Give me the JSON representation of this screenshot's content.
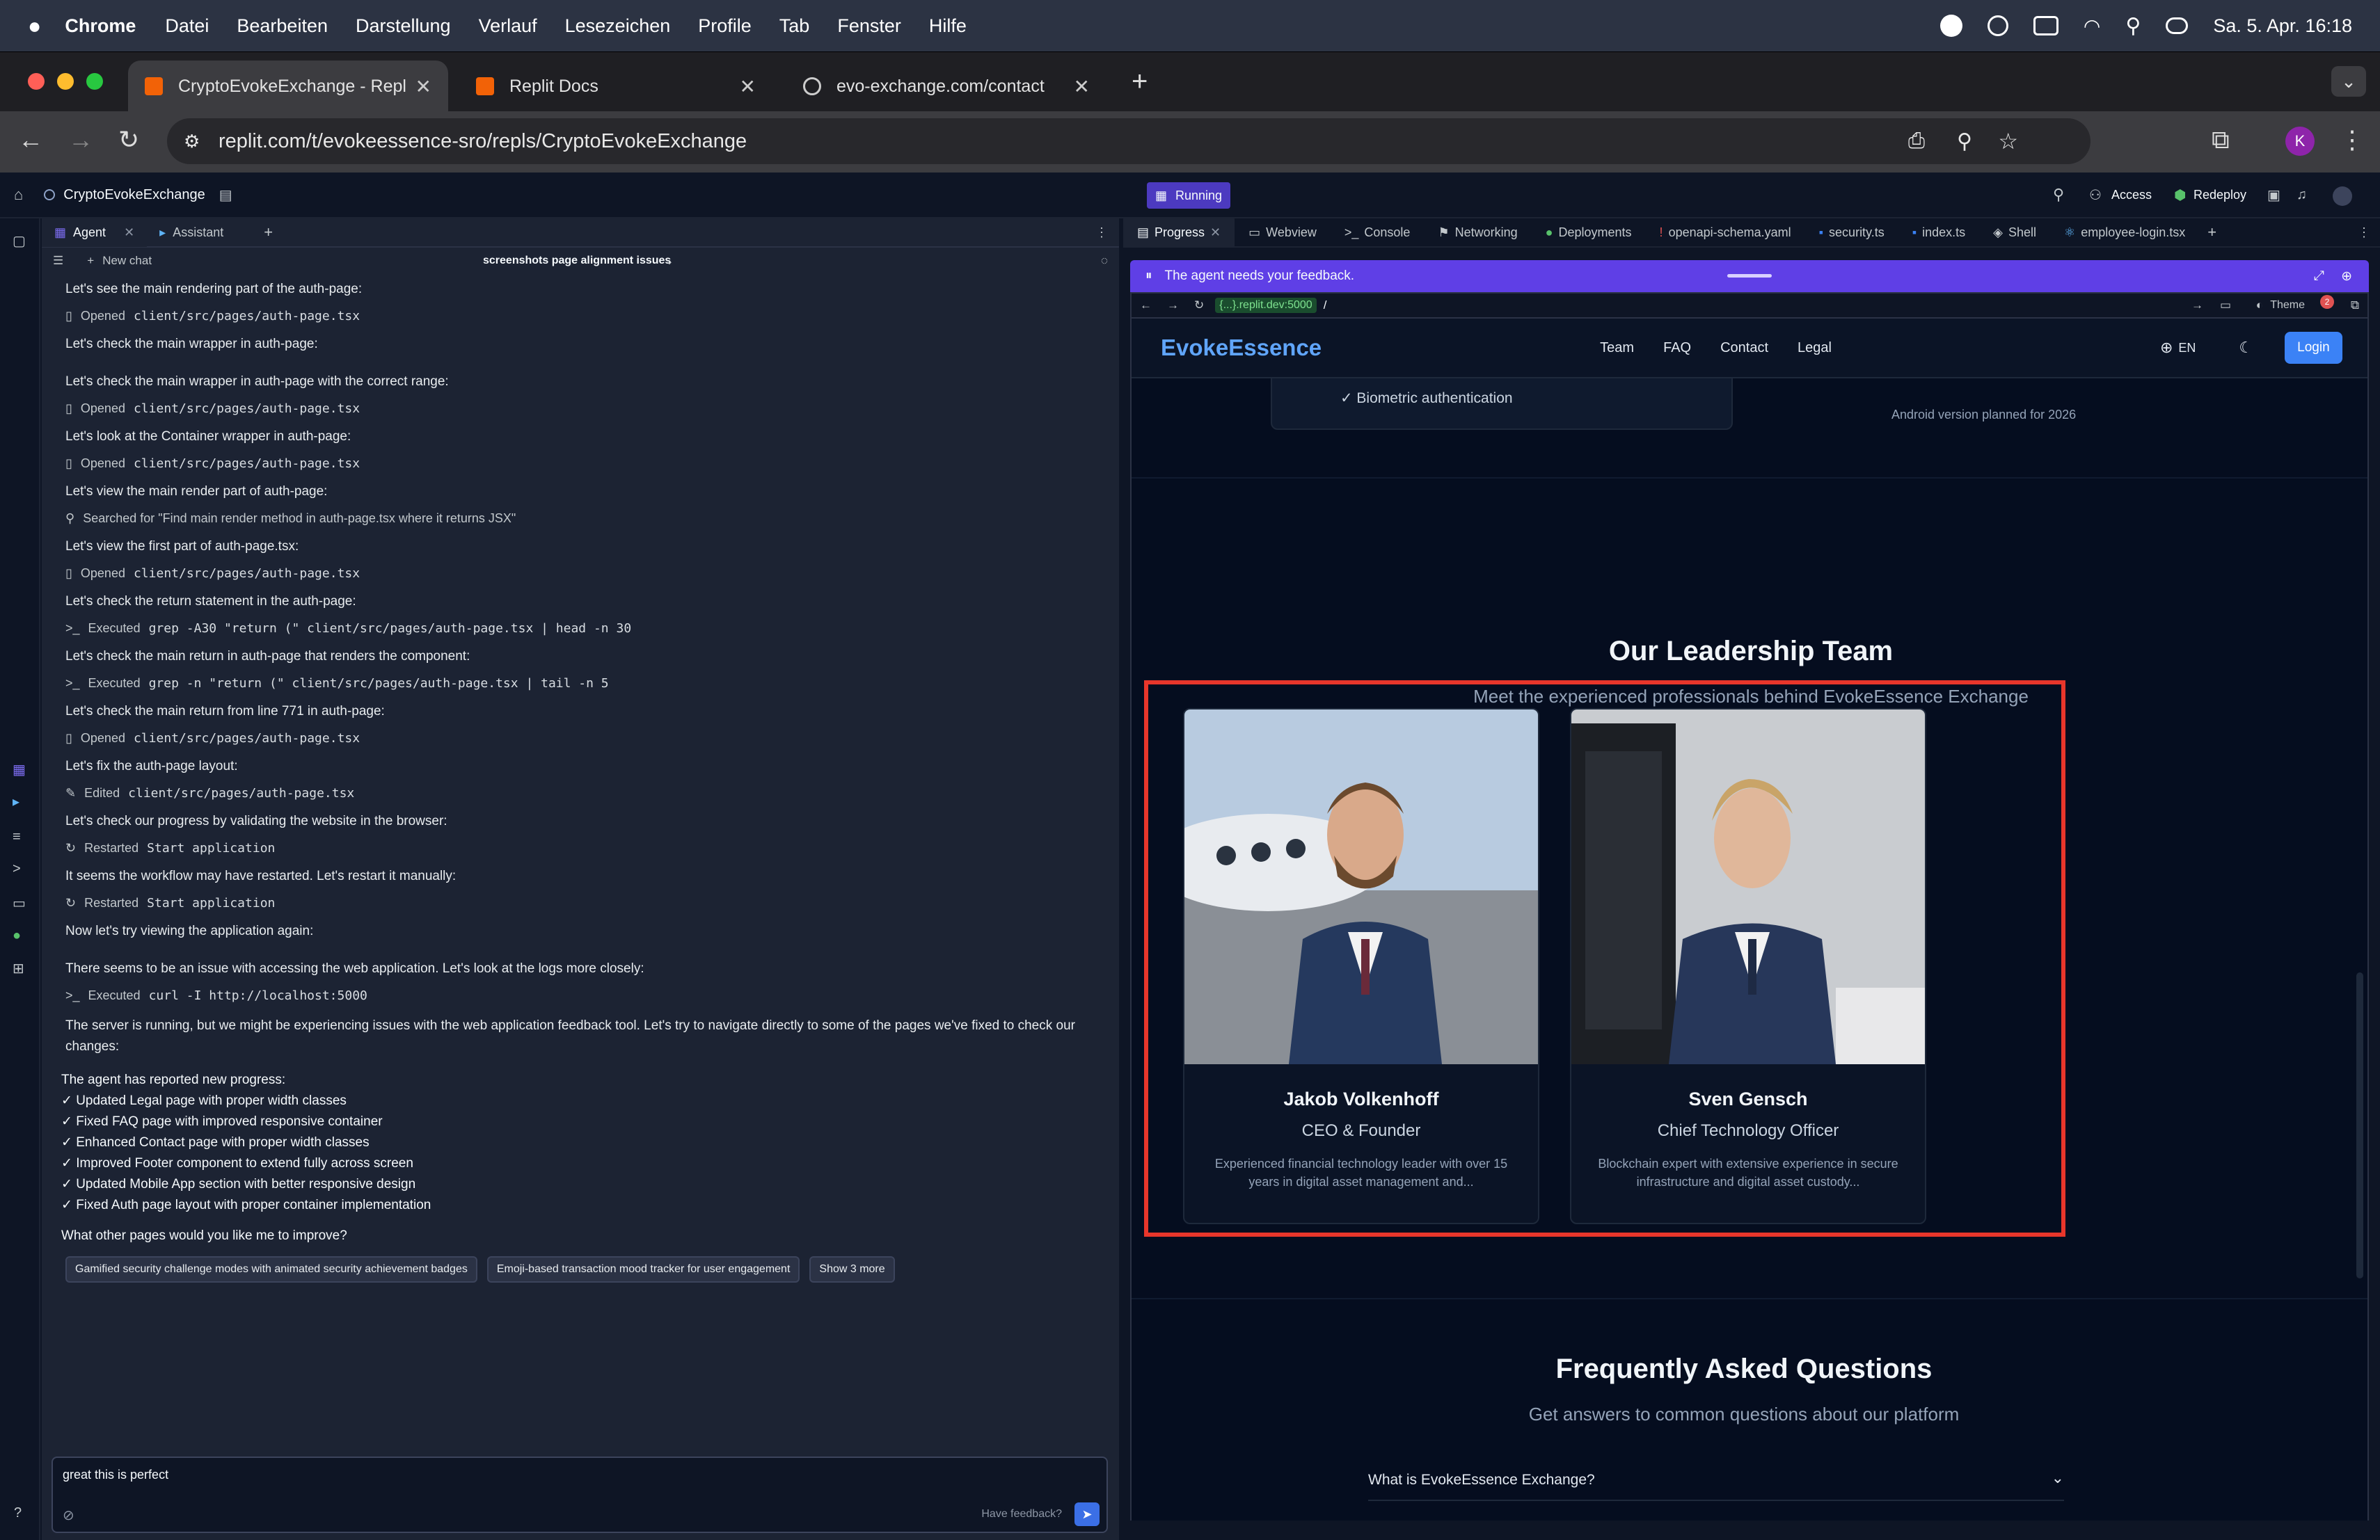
{
  "menubar": {
    "app": "Chrome",
    "items": [
      "Datei",
      "Bearbeiten",
      "Darstellung",
      "Verlauf",
      "Lesezeichen",
      "Profile",
      "Tab",
      "Fenster",
      "Hilfe"
    ],
    "clock": "Sa. 5. Apr.  16:18"
  },
  "browser": {
    "tabs": [
      {
        "title": "CryptoEvokeExchange - Repl"
      },
      {
        "title": "Replit Docs"
      },
      {
        "title": "evo-exchange.com/contact"
      }
    ],
    "url": "replit.com/t/evokeessence-sro/repls/CryptoEvokeExchange",
    "profile_initial": "K"
  },
  "replit": {
    "project": "CryptoEvokeExchange",
    "run_status": "Running",
    "access": "Access",
    "redeploy": "Redeploy",
    "agent_tabs": [
      "Agent",
      "Assistant"
    ],
    "new_chat": "New chat",
    "chat_title": "screenshots page alignment issues",
    "steps": [
      {
        "text": "Let's see the main rendering part of the auth-page:",
        "verb": "Opened",
        "code": "client/src/pages/auth-page.tsx"
      },
      {
        "text": "Let's check the main wrapper in auth-page:"
      },
      {
        "text": "Let's check the main wrapper in auth-page with the correct range:",
        "verb": "Opened",
        "code": "client/src/pages/auth-page.tsx"
      },
      {
        "text": "Let's look at the Container wrapper in auth-page:",
        "verb": "Opened",
        "code": "client/src/pages/auth-page.tsx"
      },
      {
        "text": "Let's view the main render part of auth-page:",
        "verb": "Searched for \"Find main render method in auth-page.tsx where it returns JSX\"",
        "code": ""
      },
      {
        "text": "Let's view the first part of auth-page.tsx:",
        "verb": "Opened",
        "code": "client/src/pages/auth-page.tsx"
      },
      {
        "text": "Let's check the return statement in the auth-page:",
        "verb": "Executed",
        "code": "grep -A30 \"return (\" client/src/pages/auth-page.tsx | head -n 30"
      },
      {
        "text": "Let's check the main return in auth-page that renders the component:",
        "verb": "Executed",
        "code": "grep -n \"return (\" client/src/pages/auth-page.tsx | tail -n 5"
      },
      {
        "text": "Let's check the main return from line 771 in auth-page:",
        "verb": "Opened",
        "code": "client/src/pages/auth-page.tsx"
      },
      {
        "text": "Let's fix the auth-page layout:",
        "verb": "Edited",
        "code": "client/src/pages/auth-page.tsx"
      },
      {
        "text": "Let's check our progress by validating the website in the browser:",
        "verb": "Restarted",
        "code": "Start application"
      },
      {
        "text": "It seems the workflow may have restarted. Let's restart it manually:",
        "verb": "Restarted",
        "code": "Start application"
      },
      {
        "text": "Now let's try viewing the application again:"
      },
      {
        "text": "There seems to be an issue with accessing the web application. Let's look at the logs more closely:",
        "verb": "Executed",
        "code": "curl -I http://localhost:5000"
      },
      {
        "text": "The server is running, but we might be experiencing issues with the web application feedback tool. Let's try to navigate directly to some of the pages we've fixed to check our changes:"
      }
    ],
    "progress_title": "The agent has reported new progress:",
    "progress_items": [
      "✓ Updated Legal page with proper width classes",
      "✓ Fixed FAQ page with improved responsive container",
      "✓ Enhanced Contact page with proper width classes",
      "✓ Improved Footer component to extend fully across screen",
      "✓ Updated Mobile App section with better responsive design",
      "✓ Fixed Auth page layout with proper container implementation"
    ],
    "question": "What other pages would you like me to improve?",
    "chips": [
      "Gamified security challenge modes with animated security achievement badges",
      "Emoji-based transaction mood tracker for user engagement",
      "Show 3 more"
    ],
    "input_value": "great this is perfect",
    "have_feedback": "Have feedback?",
    "right_tabs": [
      "Progress",
      "Webview",
      "Console",
      "Networking",
      "Deployments",
      "openapi-schema.yaml",
      "security.ts",
      "index.ts",
      "Shell",
      "employee-login.tsx"
    ],
    "feedback_banner": "The agent needs your feedback.",
    "webview_url_host": "{...}.replit.dev:5000",
    "webview_path": "/",
    "theme": "Theme"
  },
  "site": {
    "logo": "EvokeEssence",
    "nav": [
      "Team",
      "FAQ",
      "Contact",
      "Legal"
    ],
    "lang": "EN",
    "login": "Login",
    "biometric": "✓ Biometric authentication",
    "android": "Android version planned for 2026",
    "team_title": "Our Leadership Team",
    "team_sub": "Meet the experienced professionals behind EvokeEssence Exchange",
    "members": [
      {
        "name": "Jakob Volkenhoff",
        "role": "CEO & Founder",
        "bio": "Experienced financial technology leader with over 15 years in digital asset management and..."
      },
      {
        "name": "Sven Gensch",
        "role": "Chief Technology Officer",
        "bio": "Blockchain expert with extensive experience in secure infrastructure and digital asset custody..."
      }
    ],
    "faq_title": "Frequently Asked Questions",
    "faq_sub": "Get answers to common questions about our platform",
    "faq_q1": "What is EvokeEssence Exchange?"
  },
  "colors": {
    "highlight": "#e8362b",
    "accent": "#3b82f6",
    "feedback": "#5f3fe6"
  }
}
